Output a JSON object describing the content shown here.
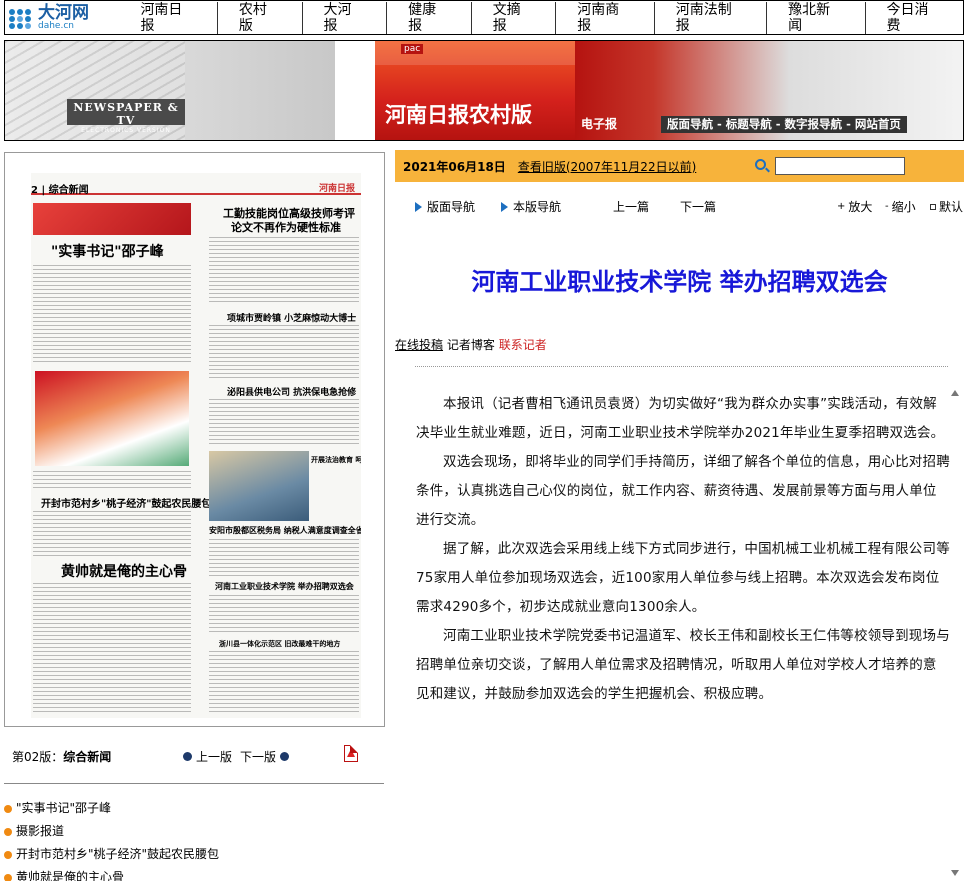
{
  "site": {
    "logo_cn": "大河网",
    "logo_en": "dahe.cn"
  },
  "nav": [
    "河南日报",
    "农村版",
    "大河报",
    "健康报",
    "文摘报",
    "河南商报",
    "河南法制报",
    "豫北新闻",
    "今日消费"
  ],
  "banner": {
    "newspaper_tv": "NEWSPAPER & TV",
    "electronics": "ELECTRONICS VERSION",
    "pac": "pac",
    "title": "河南日报农村版",
    "epaper": "电子报",
    "links": "版面导航 - 标题导航 - 数字报导航 - 网站首页"
  },
  "paper_preview": {
    "page_label": "2 | 综合新闻",
    "masthead": "河南日报",
    "hl_right_1": "工勤技能岗位高级技师考评",
    "hl_right_2": "论文不再作为硬性标准",
    "hl_left_1": "\"实事书记\"邵子峰",
    "hl_left_2": "开封市范村乡\"桃子经济\"鼓起农民腰包",
    "hl_left_3": "黄帅就是俺的主心骨",
    "hl_mid_1": "项城市贾岭镇 小芝麻惊动大博士",
    "hl_mid_2": "泌阳县供电公司 抗洪保电急抢修",
    "hl_mid_3": "开展法治教育 呵护学生成长",
    "hl_mid_4": "安阳市殷都区税务局 纳税人满意度调查全省第一",
    "hl_mid_5": "河南工业职业技术学院 举办招聘双选会",
    "hl_mid_6": "浙川县一体化示范区 旧改最难干的地方"
  },
  "left": {
    "ban_prefix": "第02版：",
    "ban_name": "综合新闻",
    "prev": "上一版",
    "next": "下一版",
    "articles": [
      "\"实事书记\"邵子峰",
      "摄影报道",
      "开封市范村乡\"桃子经济\"鼓起农民腰包",
      "黄帅就是俺的主心骨"
    ]
  },
  "datebar": {
    "date": "2021年06月18日",
    "old": "查看旧版(2007年11月22日以前)",
    "search_value": ""
  },
  "toolbar": {
    "nav1": "版面导航",
    "nav2": "本版导航",
    "prev": "上一篇",
    "next": "下一篇",
    "zoom_in": "放大",
    "zoom_out": "缩小",
    "default": "默认"
  },
  "article": {
    "title": "河南工业职业技术学院 举办招聘双选会",
    "meta_1": "在线投稿",
    "meta_2": "记者博客",
    "meta_3": "联系记者",
    "paragraphs": [
      "本报讯（记者曹相飞通讯员袁贤）为切实做好“我为群众办实事”实践活动，有效解决毕业生就业难题，近日，河南工业职业技术学院举办2021年毕业生夏季招聘双选会。",
      "双选会现场，即将毕业的同学们手持简历，详细了解各个单位的信息，用心比对招聘条件，认真挑选自己心仪的岗位，就工作内容、薪资待遇、发展前景等方面与用人单位进行交流。",
      "据了解，此次双选会采用线上线下方式同步进行，中国机械工业机械工程有限公司等75家用人单位参加现场双选会，近100家用人单位参与线上招聘。本次双选会发布岗位需求4290多个，初步达成就业意向1300余人。",
      "河南工业职业技术学院党委书记温道军、校长王伟和副校长王仁伟等校领导到现场与招聘单位亲切交谈，了解用人单位需求及招聘情况，听取用人单位对学校人才培养的意见和建议，并鼓励参加双选会的学生把握机会、积极应聘。"
    ]
  },
  "colors": {
    "accent": "#f7b33b",
    "title_blue": "#1818d8",
    "red": "#cc2222",
    "bullet": "#f08a12"
  }
}
